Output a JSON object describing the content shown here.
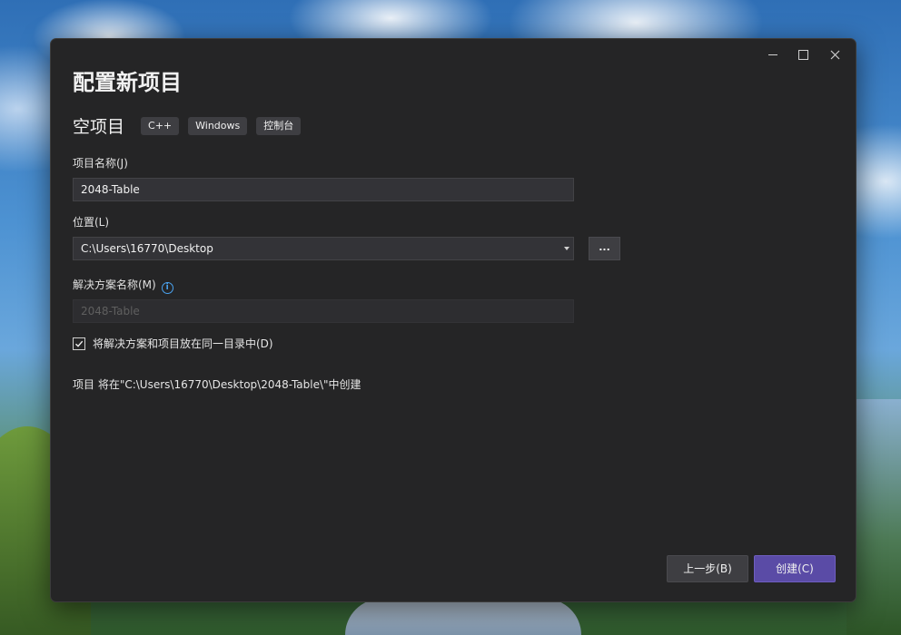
{
  "dialog": {
    "title": "配置新项目",
    "template_name": "空项目",
    "tags": [
      "C++",
      "Windows",
      "控制台"
    ],
    "window_controls": [
      "minimize-icon",
      "maximize-icon",
      "close-icon"
    ]
  },
  "form": {
    "project_name_label": "项目名称(J)",
    "project_name_value": "2048-Table",
    "location_label": "位置(L)",
    "location_value": "C:\\Users\\16770\\Desktop",
    "browse_label": "...",
    "solution_name_label": "解决方案名称(M)",
    "solution_name_value": "2048-Table",
    "info_icon": "info-icon",
    "same_dir_checked": true,
    "same_dir_label": "将解决方案和项目放在同一目录中(D)",
    "summary": "项目 将在\"C:\\Users\\16770\\Desktop\\2048-Table\\\"中创建"
  },
  "buttons": {
    "back_label": "上一步(B)",
    "create_label": "创建(C)"
  },
  "colors": {
    "dialog_bg": "#252526",
    "accent": "#5a4ba6",
    "info": "#4aa3f0"
  }
}
